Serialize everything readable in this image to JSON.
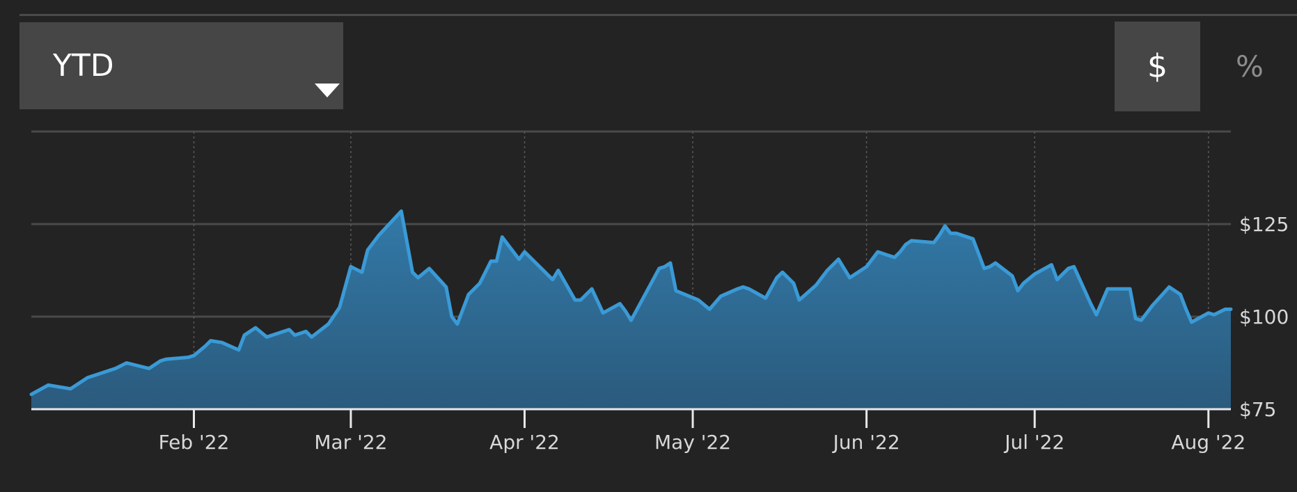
{
  "controls": {
    "range_label": "YTD",
    "unit_dollar_label": "$",
    "unit_percent_label": "%",
    "active_unit": "$"
  },
  "colors": {
    "background": "#232323",
    "line": "#3a9ad6",
    "fill_top": "#3279a8",
    "fill_bottom": "#2b5a7c",
    "grid": "#4a4a4a",
    "axis_text": "#d8d8d8"
  },
  "chart_data": {
    "type": "area",
    "title": "",
    "xlabel": "",
    "ylabel": "",
    "x_range": [
      "2022-01-03",
      "2022-08-05"
    ],
    "ylim": [
      75,
      150
    ],
    "y_ticks": [
      {
        "value": 75,
        "label": "$75"
      },
      {
        "value": 100,
        "label": "$100"
      },
      {
        "value": 125,
        "label": "$125"
      }
    ],
    "x_ticks": [
      {
        "date": "2022-02-01",
        "label": "Feb '22"
      },
      {
        "date": "2022-03-01",
        "label": "Mar '22"
      },
      {
        "date": "2022-04-01",
        "label": "Apr '22"
      },
      {
        "date": "2022-05-01",
        "label": "May '22"
      },
      {
        "date": "2022-06-01",
        "label": "Jun '22"
      },
      {
        "date": "2022-07-01",
        "label": "Jul '22"
      },
      {
        "date": "2022-08-01",
        "label": "Aug '22"
      }
    ],
    "grid": "horizontal solid, vertical dotted at month starts",
    "y_axis_position": "right",
    "series": [
      {
        "dates": [
          "2022-01-03",
          "2022-01-06",
          "2022-01-10",
          "2022-01-13",
          "2022-01-14",
          "2022-01-17",
          "2022-01-18",
          "2022-01-20",
          "2022-01-24",
          "2022-01-26",
          "2022-01-27",
          "2022-01-31",
          "2022-02-01",
          "2022-02-03",
          "2022-02-04",
          "2022-02-06",
          "2022-02-09",
          "2022-02-10",
          "2022-02-12",
          "2022-02-14",
          "2022-02-18",
          "2022-02-19",
          "2022-02-21",
          "2022-02-22",
          "2022-02-25",
          "2022-02-27",
          "2022-03-01",
          "2022-03-03",
          "2022-03-04",
          "2022-03-06",
          "2022-03-10",
          "2022-03-12",
          "2022-03-13",
          "2022-03-15",
          "2022-03-18",
          "2022-03-19",
          "2022-03-20",
          "2022-03-22",
          "2022-03-24",
          "2022-03-26",
          "2022-03-27",
          "2022-03-28",
          "2022-03-31",
          "2022-04-01",
          "2022-04-04",
          "2022-04-06",
          "2022-04-07",
          "2022-04-10",
          "2022-04-11",
          "2022-04-13",
          "2022-04-15",
          "2022-04-18",
          "2022-04-19",
          "2022-04-20",
          "2022-04-25",
          "2022-04-26",
          "2022-04-27",
          "2022-04-28",
          "2022-05-02",
          "2022-05-04",
          "2022-05-06",
          "2022-05-09",
          "2022-05-10",
          "2022-05-11",
          "2022-05-14",
          "2022-05-16",
          "2022-05-17",
          "2022-05-19",
          "2022-05-20",
          "2022-05-23",
          "2022-05-25",
          "2022-05-26",
          "2022-05-27",
          "2022-05-29",
          "2022-06-01",
          "2022-06-03",
          "2022-06-06",
          "2022-06-07",
          "2022-06-08",
          "2022-06-09",
          "2022-06-13",
          "2022-06-14",
          "2022-06-15",
          "2022-06-16",
          "2022-06-17",
          "2022-06-20",
          "2022-06-22",
          "2022-06-23",
          "2022-06-24",
          "2022-06-27",
          "2022-06-28",
          "2022-06-29",
          "2022-07-01",
          "2022-07-04",
          "2022-07-05",
          "2022-07-07",
          "2022-07-08",
          "2022-07-11",
          "2022-07-12",
          "2022-07-14",
          "2022-07-18",
          "2022-07-19",
          "2022-07-20",
          "2022-07-22",
          "2022-07-25",
          "2022-07-27",
          "2022-07-28",
          "2022-07-29",
          "2022-08-01",
          "2022-08-02",
          "2022-08-04",
          "2022-08-05"
        ],
        "values": [
          79.0,
          81.5,
          80.5,
          83.5,
          84.0,
          85.5,
          86.0,
          87.5,
          86.0,
          88.0,
          88.5,
          89.0,
          89.5,
          92.0,
          93.5,
          93.0,
          91.0,
          95.0,
          97.0,
          94.5,
          96.5,
          95.0,
          96.0,
          94.5,
          98.0,
          102.5,
          113.5,
          112.0,
          118.0,
          122.0,
          128.5,
          112.0,
          110.5,
          113.0,
          108.0,
          100.0,
          98.0,
          106.0,
          109.0,
          115.0,
          115.0,
          121.5,
          115.5,
          117.5,
          113.0,
          110.0,
          112.5,
          104.5,
          104.5,
          107.5,
          101.0,
          103.5,
          101.5,
          99.0,
          113.0,
          113.5,
          114.5,
          107.0,
          104.5,
          102.0,
          105.5,
          107.5,
          108.0,
          107.5,
          105.0,
          110.5,
          112.0,
          109.0,
          104.5,
          108.5,
          112.5,
          114.0,
          115.5,
          110.5,
          113.5,
          117.5,
          116.0,
          117.5,
          119.5,
          120.5,
          120.0,
          122.0,
          124.5,
          122.5,
          122.5,
          121.0,
          113.0,
          113.5,
          114.5,
          111.0,
          107.0,
          109.0,
          111.5,
          114.0,
          110.0,
          113.0,
          113.5,
          103.5,
          100.5,
          107.5,
          107.5,
          99.5,
          99.0,
          103.0,
          108.0,
          106.0,
          102.0,
          98.5,
          101.0,
          100.5,
          102.0,
          102.0
        ]
      }
    ]
  }
}
